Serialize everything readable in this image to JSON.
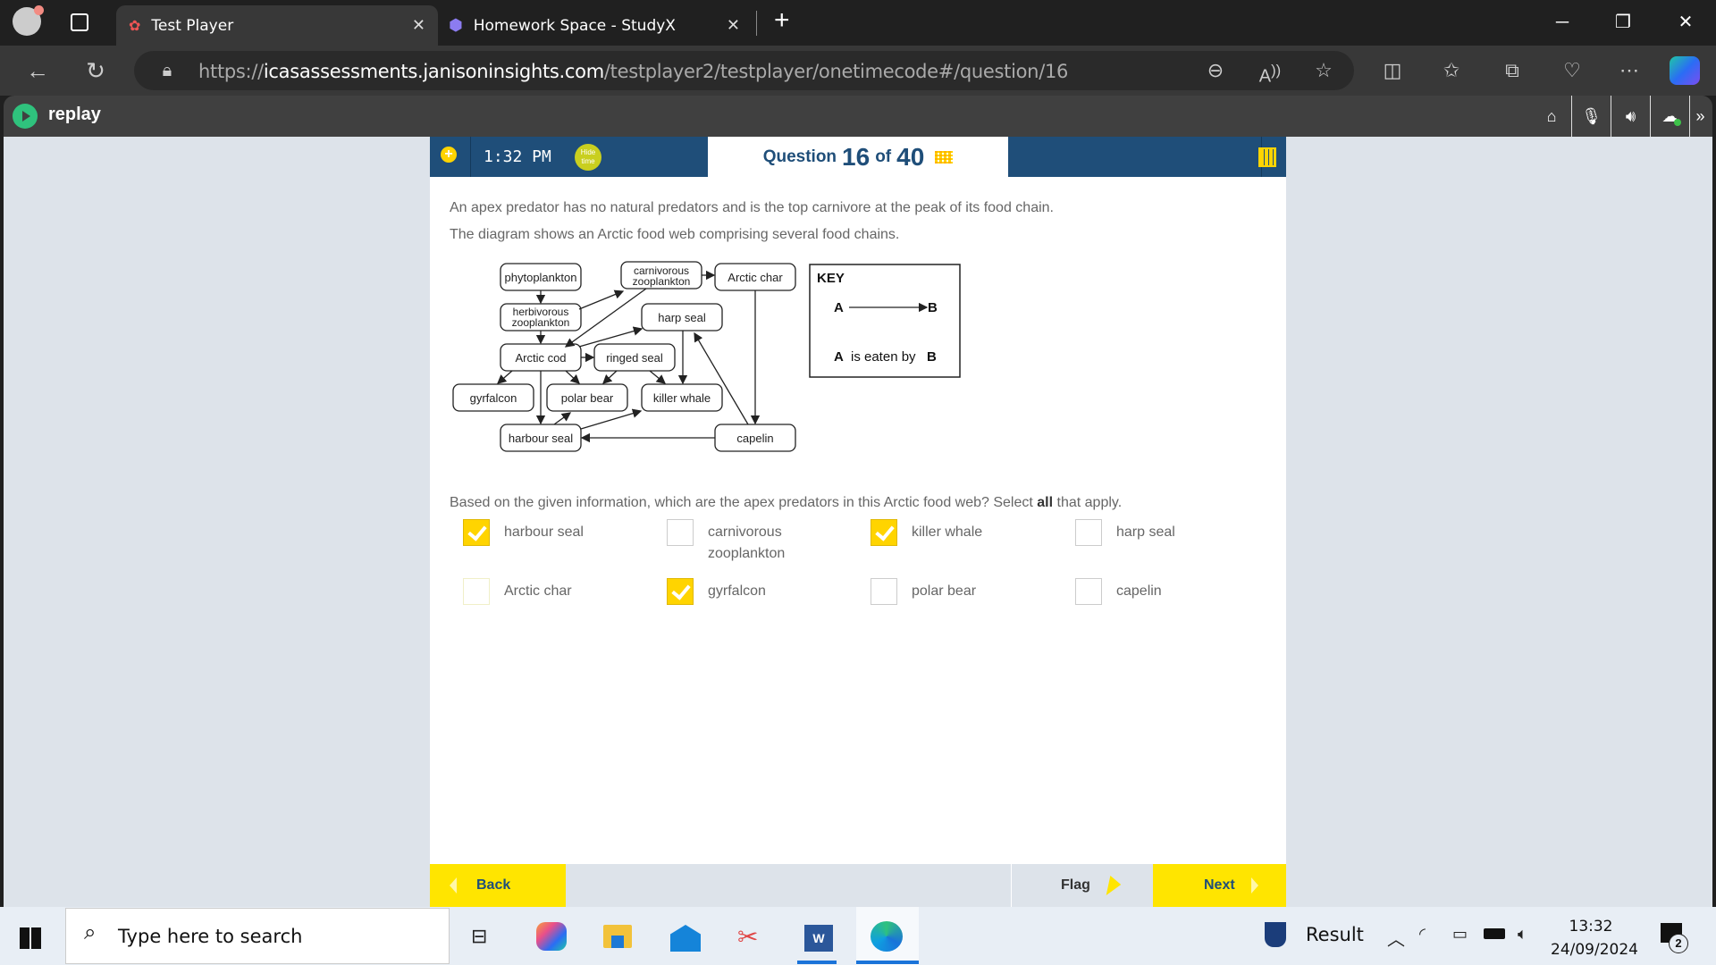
{
  "browser": {
    "tabs": [
      {
        "title": "Test Player",
        "active": true
      },
      {
        "title": "Homework Space - StudyX",
        "active": false
      }
    ],
    "url": {
      "prefix": "https://",
      "domain": "icasassessments.janisoninsights.com",
      "path": "/testplayer2/testplayer/onetimecode#/question/16"
    }
  },
  "replay": {
    "logo_text": "replay",
    "toolbar": [
      "home-icon",
      "microphone-icon",
      "speaker-icon",
      "cloud-icon",
      "more-icon"
    ]
  },
  "header": {
    "time": "1:32 PM",
    "hide_time_label": "Hide time",
    "question_label": "Question",
    "question_number": "16",
    "of_label": "of",
    "total_questions": "40"
  },
  "question": {
    "intro1": "An apex predator has no natural predators and is the top carnivore at the peak of its food chain.",
    "intro2": "The diagram shows an Arctic food web comprising several food chains.",
    "prompt_before": "Based on the given information, which are the apex predators in this Arctic food web? Select ",
    "prompt_bold": "all",
    "prompt_after": " that apply.",
    "options": [
      {
        "label": "harbour seal",
        "checked": true
      },
      {
        "label": "carnivorous zooplankton",
        "checked": false
      },
      {
        "label": "killer whale",
        "checked": true
      },
      {
        "label": "harp seal",
        "checked": false
      },
      {
        "label": "Arctic char",
        "checked": false
      },
      {
        "label": "gyrfalcon",
        "checked": true
      },
      {
        "label": "polar bear",
        "checked": false
      },
      {
        "label": "capelin",
        "checked": false
      }
    ]
  },
  "diagram": {
    "nodes": {
      "phyto": "phytoplankton",
      "carnzoo1": "carnivorous",
      "carnzoo2": "zooplankton",
      "char": "Arctic char",
      "herb1": "herbivorous",
      "herb2": "zooplankton",
      "harp": "harp seal",
      "cod": "Arctic cod",
      "ringed": "ringed seal",
      "gyr": "gyrfalcon",
      "polar": "polar bear",
      "killer": "killer whale",
      "harbour": "harbour seal",
      "capelin": "capelin"
    },
    "key": {
      "title": "KEY",
      "a": "A",
      "b": "B",
      "is_eaten_by": "is eaten by"
    }
  },
  "footer": {
    "back": "Back",
    "flag": "Flag",
    "next": "Next"
  },
  "taskbar": {
    "search_placeholder": "Type here to search",
    "news": "Result",
    "time": "13:32",
    "date": "24/09/2024",
    "notifications": "2"
  }
}
